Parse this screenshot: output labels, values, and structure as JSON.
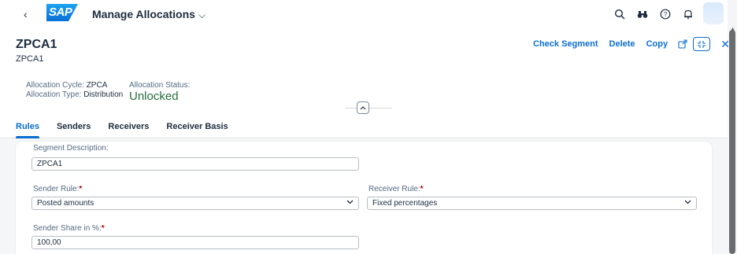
{
  "shell": {
    "back_icon": "chevron-left",
    "logo_text": "SAP",
    "app_title": "Manage Allocations",
    "title_chevron": "⌄",
    "icons": [
      "search-icon",
      "binoculars-icon",
      "help-icon",
      "bell-icon"
    ]
  },
  "header": {
    "title": "ZPCA1",
    "subtitle": "ZPCA1",
    "actions": {
      "check_segment": "Check Segment",
      "delete": "Delete",
      "copy": "Copy"
    },
    "attributes": {
      "cycle_label": "Allocation Cycle:",
      "cycle_value": "ZPCA",
      "type_label": "Allocation Type:",
      "type_value": "Distribution",
      "status_label": "Allocation Status:",
      "status_value": "Unlocked"
    },
    "status_color": "#256f3a",
    "accent_color": "#0a6ed1"
  },
  "tabs": [
    {
      "label": "Rules",
      "active": true
    },
    {
      "label": "Senders",
      "active": false
    },
    {
      "label": "Receivers",
      "active": false
    },
    {
      "label": "Receiver Basis",
      "active": false
    }
  ],
  "form": {
    "segment_description": {
      "label": "Segment Description:",
      "value": "ZPCA1"
    },
    "sender_rule": {
      "label": "Sender Rule:",
      "required": "*",
      "value": "Posted amounts"
    },
    "receiver_rule": {
      "label": "Receiver Rule:",
      "required": "*",
      "value": "Fixed percentages"
    },
    "sender_share": {
      "label": "Sender Share in %:",
      "required": "*",
      "value": "100,00"
    }
  }
}
